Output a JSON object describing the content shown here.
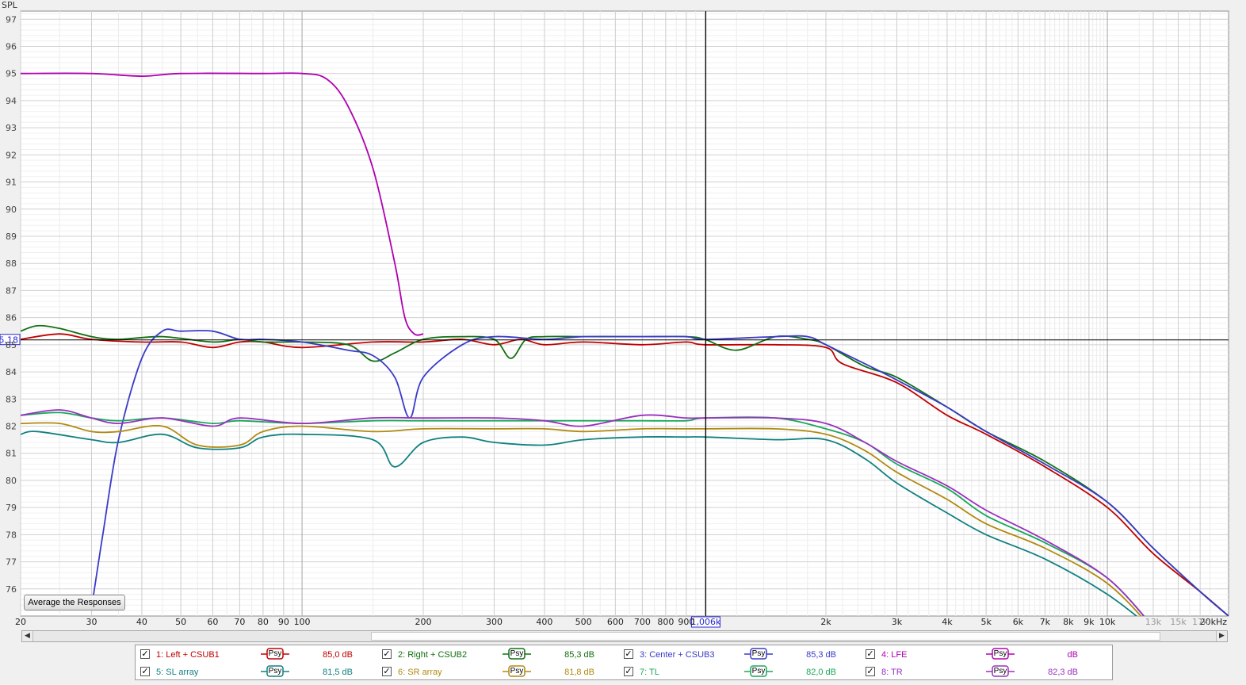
{
  "app": {
    "average_button_label": "Average the Responses"
  },
  "chart_data": {
    "type": "line",
    "ylabel": "SPL",
    "xunit_label": "20kHz",
    "xscale": "log",
    "xlim": [
      20,
      20000
    ],
    "ylim": [
      75,
      97.3
    ],
    "grid": true,
    "y_ticks": [
      "97",
      "96",
      "95",
      "94",
      "93",
      "92",
      "91",
      "90",
      "89",
      "88",
      "87",
      "86",
      "85",
      "84",
      "83",
      "82",
      "81",
      "80",
      "79",
      "78",
      "77",
      "76"
    ],
    "x_ticks": [
      {
        "v": 20,
        "t": "20"
      },
      {
        "v": 30,
        "t": "30"
      },
      {
        "v": 40,
        "t": "40"
      },
      {
        "v": 50,
        "t": "50"
      },
      {
        "v": 60,
        "t": "60"
      },
      {
        "v": 70,
        "t": "70"
      },
      {
        "v": 80,
        "t": "80"
      },
      {
        "v": 90,
        "t": "90"
      },
      {
        "v": 100,
        "t": "100"
      },
      {
        "v": 200,
        "t": "200"
      },
      {
        "v": 300,
        "t": "300"
      },
      {
        "v": 400,
        "t": "400"
      },
      {
        "v": 500,
        "t": "500"
      },
      {
        "v": 600,
        "t": "600"
      },
      {
        "v": 700,
        "t": "700"
      },
      {
        "v": 800,
        "t": "800"
      },
      {
        "v": 900,
        "t": "900"
      },
      {
        "v": 2000,
        "t": "2k"
      },
      {
        "v": 3000,
        "t": "3k"
      },
      {
        "v": 4000,
        "t": "4k"
      },
      {
        "v": 5000,
        "t": "5k"
      },
      {
        "v": 6000,
        "t": "6k"
      },
      {
        "v": 7000,
        "t": "7k"
      },
      {
        "v": 8000,
        "t": "8k"
      },
      {
        "v": 9000,
        "t": "9k"
      },
      {
        "v": 10000,
        "t": "10k"
      },
      {
        "v": 13000,
        "t": "13k",
        "dim": true
      },
      {
        "v": 15000,
        "t": "15k",
        "dim": true
      },
      {
        "v": 17000,
        "t": "17k",
        "dim": true
      }
    ],
    "cursor": {
      "x": 1006,
      "y": 85.18,
      "x_label": "1,006k",
      "y_label": "85,18"
    },
    "series": [
      {
        "name": "1: Left + CSUB1",
        "color": "#c00000",
        "points": [
          [
            20,
            85.2
          ],
          [
            25,
            85.4
          ],
          [
            30,
            85.2
          ],
          [
            40,
            85.1
          ],
          [
            50,
            85.1
          ],
          [
            60,
            84.9
          ],
          [
            70,
            85.1
          ],
          [
            80,
            85.1
          ],
          [
            100,
            84.9
          ],
          [
            150,
            85.1
          ],
          [
            200,
            85.1
          ],
          [
            250,
            85.2
          ],
          [
            300,
            85.0
          ],
          [
            350,
            85.2
          ],
          [
            400,
            85.0
          ],
          [
            500,
            85.1
          ],
          [
            700,
            85.0
          ],
          [
            900,
            85.1
          ],
          [
            1000,
            85.0
          ],
          [
            1500,
            85.0
          ],
          [
            2000,
            84.9
          ],
          [
            2200,
            84.3
          ],
          [
            3000,
            83.6
          ],
          [
            4000,
            82.4
          ],
          [
            5000,
            81.7
          ],
          [
            7000,
            80.5
          ],
          [
            10000,
            79.0
          ],
          [
            13000,
            77.3
          ],
          [
            17000,
            75.9
          ],
          [
            20000,
            75.0
          ]
        ]
      },
      {
        "name": "2: Right + CSUB2",
        "color": "#107010",
        "points": [
          [
            20,
            85.5
          ],
          [
            22,
            85.7
          ],
          [
            25,
            85.6
          ],
          [
            30,
            85.3
          ],
          [
            35,
            85.2
          ],
          [
            45,
            85.3
          ],
          [
            60,
            85.1
          ],
          [
            70,
            85.2
          ],
          [
            80,
            85.1
          ],
          [
            100,
            85.1
          ],
          [
            130,
            85.0
          ],
          [
            150,
            84.4
          ],
          [
            170,
            84.7
          ],
          [
            200,
            85.2
          ],
          [
            250,
            85.3
          ],
          [
            300,
            85.2
          ],
          [
            330,
            84.5
          ],
          [
            360,
            85.2
          ],
          [
            400,
            85.3
          ],
          [
            500,
            85.3
          ],
          [
            700,
            85.3
          ],
          [
            900,
            85.3
          ],
          [
            1000,
            85.2
          ],
          [
            1200,
            84.8
          ],
          [
            1500,
            85.3
          ],
          [
            1800,
            85.2
          ],
          [
            2000,
            85.0
          ],
          [
            2500,
            84.2
          ],
          [
            3000,
            83.8
          ],
          [
            4000,
            82.7
          ],
          [
            5000,
            81.8
          ],
          [
            7000,
            80.7
          ],
          [
            10000,
            79.2
          ],
          [
            13000,
            77.5
          ],
          [
            17000,
            75.9
          ],
          [
            20000,
            75.0
          ]
        ]
      },
      {
        "name": "3: Center + CSUB3",
        "color": "#3a3ac8",
        "points": [
          [
            30,
            75.3
          ],
          [
            32,
            78.0
          ],
          [
            35,
            81.5
          ],
          [
            40,
            84.5
          ],
          [
            45,
            85.5
          ],
          [
            50,
            85.5
          ],
          [
            60,
            85.5
          ],
          [
            70,
            85.2
          ],
          [
            80,
            85.2
          ],
          [
            100,
            85.1
          ],
          [
            130,
            84.8
          ],
          [
            150,
            84.6
          ],
          [
            170,
            83.8
          ],
          [
            185,
            82.3
          ],
          [
            200,
            83.8
          ],
          [
            250,
            85.0
          ],
          [
            300,
            85.3
          ],
          [
            400,
            85.2
          ],
          [
            500,
            85.3
          ],
          [
            700,
            85.3
          ],
          [
            900,
            85.3
          ],
          [
            1000,
            85.2
          ],
          [
            1500,
            85.3
          ],
          [
            1800,
            85.3
          ],
          [
            2000,
            85.0
          ],
          [
            2500,
            84.3
          ],
          [
            3000,
            83.7
          ],
          [
            4000,
            82.7
          ],
          [
            5000,
            81.8
          ],
          [
            7000,
            80.6
          ],
          [
            10000,
            79.2
          ],
          [
            13000,
            77.5
          ],
          [
            17000,
            75.9
          ],
          [
            20000,
            75.0
          ]
        ]
      },
      {
        "name": "4: LFE",
        "color": "#b000b0",
        "points": [
          [
            20,
            95.0
          ],
          [
            30,
            95.0
          ],
          [
            40,
            94.9
          ],
          [
            50,
            95.0
          ],
          [
            80,
            95.0
          ],
          [
            100,
            95.0
          ],
          [
            115,
            94.8
          ],
          [
            130,
            93.8
          ],
          [
            150,
            91.5
          ],
          [
            170,
            88.0
          ],
          [
            180,
            86.0
          ],
          [
            190,
            85.4
          ],
          [
            200,
            85.4
          ]
        ]
      },
      {
        "name": "5: SL array",
        "color": "#108080",
        "points": [
          [
            20,
            81.7
          ],
          [
            22,
            81.8
          ],
          [
            30,
            81.5
          ],
          [
            35,
            81.4
          ],
          [
            45,
            81.7
          ],
          [
            55,
            81.2
          ],
          [
            70,
            81.2
          ],
          [
            80,
            81.6
          ],
          [
            100,
            81.7
          ],
          [
            150,
            81.5
          ],
          [
            170,
            80.5
          ],
          [
            200,
            81.4
          ],
          [
            250,
            81.6
          ],
          [
            300,
            81.4
          ],
          [
            400,
            81.3
          ],
          [
            500,
            81.5
          ],
          [
            700,
            81.6
          ],
          [
            900,
            81.6
          ],
          [
            1000,
            81.6
          ],
          [
            1500,
            81.5
          ],
          [
            2000,
            81.5
          ],
          [
            2500,
            80.8
          ],
          [
            3000,
            79.9
          ],
          [
            4000,
            78.8
          ],
          [
            5000,
            78.0
          ],
          [
            7000,
            77.1
          ],
          [
            10000,
            75.8
          ],
          [
            13000,
            74.5
          ]
        ]
      },
      {
        "name": "6: SR array",
        "color": "#b08a10",
        "points": [
          [
            20,
            82.1
          ],
          [
            25,
            82.1
          ],
          [
            30,
            81.8
          ],
          [
            35,
            81.8
          ],
          [
            45,
            82.0
          ],
          [
            55,
            81.3
          ],
          [
            70,
            81.3
          ],
          [
            80,
            81.8
          ],
          [
            100,
            82.0
          ],
          [
            150,
            81.8
          ],
          [
            200,
            81.9
          ],
          [
            300,
            81.9
          ],
          [
            400,
            81.9
          ],
          [
            500,
            81.8
          ],
          [
            700,
            81.9
          ],
          [
            900,
            81.9
          ],
          [
            1000,
            81.9
          ],
          [
            1500,
            81.9
          ],
          [
            2000,
            81.7
          ],
          [
            2500,
            81.1
          ],
          [
            3000,
            80.3
          ],
          [
            4000,
            79.3
          ],
          [
            5000,
            78.4
          ],
          [
            7000,
            77.5
          ],
          [
            10000,
            76.2
          ],
          [
            13000,
            74.5
          ]
        ]
      },
      {
        "name": "7: TL",
        "color": "#18a858",
        "points": [
          [
            20,
            82.4
          ],
          [
            25,
            82.5
          ],
          [
            30,
            82.3
          ],
          [
            35,
            82.2
          ],
          [
            45,
            82.3
          ],
          [
            60,
            82.1
          ],
          [
            70,
            82.2
          ],
          [
            100,
            82.1
          ],
          [
            150,
            82.2
          ],
          [
            200,
            82.2
          ],
          [
            300,
            82.2
          ],
          [
            400,
            82.2
          ],
          [
            500,
            82.2
          ],
          [
            700,
            82.2
          ],
          [
            900,
            82.2
          ],
          [
            1000,
            82.3
          ],
          [
            1500,
            82.3
          ],
          [
            2000,
            81.9
          ],
          [
            2500,
            81.4
          ],
          [
            3000,
            80.6
          ],
          [
            4000,
            79.7
          ],
          [
            5000,
            78.7
          ],
          [
            7000,
            77.7
          ],
          [
            10000,
            76.4
          ],
          [
            13000,
            74.6
          ]
        ]
      },
      {
        "name": "8: TR",
        "color": "#9a30c0",
        "points": [
          [
            20,
            82.4
          ],
          [
            25,
            82.6
          ],
          [
            30,
            82.3
          ],
          [
            35,
            82.1
          ],
          [
            45,
            82.3
          ],
          [
            60,
            82.0
          ],
          [
            70,
            82.3
          ],
          [
            100,
            82.1
          ],
          [
            150,
            82.3
          ],
          [
            200,
            82.3
          ],
          [
            300,
            82.3
          ],
          [
            400,
            82.2
          ],
          [
            500,
            82.0
          ],
          [
            700,
            82.4
          ],
          [
            900,
            82.3
          ],
          [
            1000,
            82.3
          ],
          [
            1500,
            82.3
          ],
          [
            2000,
            82.1
          ],
          [
            2500,
            81.4
          ],
          [
            3000,
            80.7
          ],
          [
            4000,
            79.8
          ],
          [
            5000,
            78.9
          ],
          [
            7000,
            77.8
          ],
          [
            10000,
            76.4
          ],
          [
            13000,
            74.6
          ]
        ]
      }
    ]
  },
  "legend": {
    "items": [
      {
        "name": "1: Left + CSUB1",
        "value": "85,0 dB",
        "color": "#c00000",
        "psy": "Psy",
        "checked": "✓"
      },
      {
        "name": "2: Right + CSUB2",
        "value": "85,3 dB",
        "color": "#107010",
        "psy": "Psy",
        "checked": "✓"
      },
      {
        "name": "3: Center + CSUB3",
        "value": "85,3 dB",
        "color": "#3a3ac8",
        "psy": "Psy",
        "checked": "✓"
      },
      {
        "name": "4: LFE",
        "value": "dB",
        "color": "#b000b0",
        "psy": "Psy",
        "checked": "✓"
      },
      {
        "name": "5: SL array",
        "value": "81,5 dB",
        "color": "#108080",
        "psy": "Psy",
        "checked": "✓"
      },
      {
        "name": "6: SR array",
        "value": "81,8 dB",
        "color": "#b08a10",
        "psy": "Psy",
        "checked": "✓"
      },
      {
        "name": "7: TL",
        "value": "82,0 dB",
        "color": "#18a858",
        "psy": "Psy",
        "checked": "✓"
      },
      {
        "name": "8: TR",
        "value": "82,3 dB",
        "color": "#9a30c0",
        "psy": "Psy",
        "checked": "✓"
      }
    ]
  }
}
